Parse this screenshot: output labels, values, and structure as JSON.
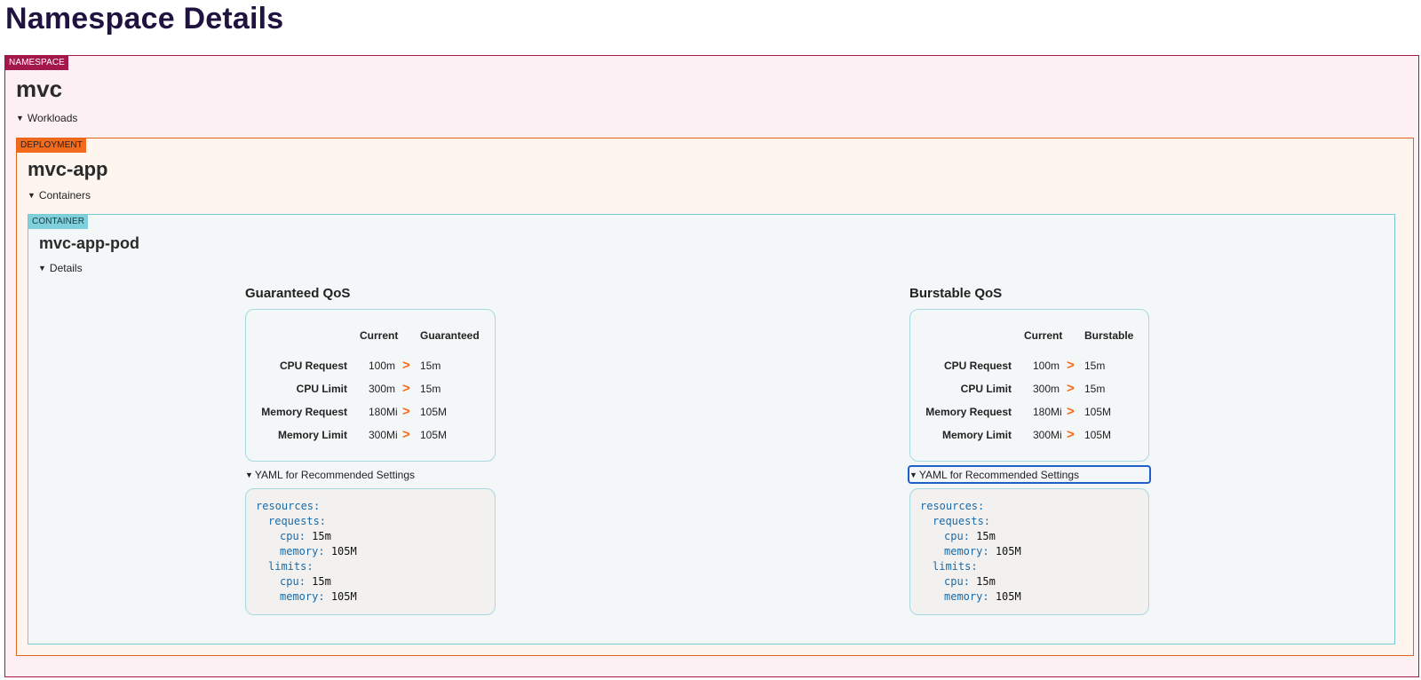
{
  "page": {
    "title": "Namespace Details"
  },
  "namespace": {
    "tag": "NAMESPACE",
    "name": "mvc",
    "section_label": "Workloads"
  },
  "deployment": {
    "tag": "DEPLOYMENT",
    "name": "mvc-app",
    "section_label": "Containers"
  },
  "container": {
    "tag": "CONTAINER",
    "name": "mvc-app-pod",
    "section_label": "Details"
  },
  "qos": [
    {
      "title": "Guaranteed QoS",
      "header_current": "Current",
      "header_recommended": "Guaranteed",
      "arrow": ">",
      "rows": [
        {
          "label": "CPU Request",
          "current": "100m",
          "recommended": "15m"
        },
        {
          "label": "CPU Limit",
          "current": "300m",
          "recommended": "15m"
        },
        {
          "label": "Memory Request",
          "current": "180Mi",
          "recommended": "105M"
        },
        {
          "label": "Memory Limit",
          "current": "300Mi",
          "recommended": "105M"
        }
      ],
      "yaml_summary": "YAML for Recommended Settings",
      "yaml": {
        "resources": "resources",
        "requests": "requests",
        "limits": "limits",
        "cpu_key": "cpu",
        "memory_key": "memory",
        "requests_cpu": "15m",
        "requests_memory": "105M",
        "limits_cpu": "15m",
        "limits_memory": "105M"
      }
    },
    {
      "title": "Burstable QoS",
      "header_current": "Current",
      "header_recommended": "Burstable",
      "arrow": ">",
      "rows": [
        {
          "label": "CPU Request",
          "current": "100m",
          "recommended": "15m"
        },
        {
          "label": "CPU Limit",
          "current": "300m",
          "recommended": "15m"
        },
        {
          "label": "Memory Request",
          "current": "180Mi",
          "recommended": "105M"
        },
        {
          "label": "Memory Limit",
          "current": "300Mi",
          "recommended": "105M"
        }
      ],
      "yaml_summary": "YAML for Recommended Settings",
      "yaml": {
        "resources": "resources",
        "requests": "requests",
        "limits": "limits",
        "cpu_key": "cpu",
        "memory_key": "memory",
        "requests_cpu": "15m",
        "requests_memory": "105M",
        "limits_cpu": "15m",
        "limits_memory": "105M"
      }
    }
  ],
  "icons": {
    "expanded": "triangle-down-icon",
    "arrow": "chevron-right-icon"
  },
  "colors": {
    "namespace": "#a4174a",
    "deployment": "#f26a1b",
    "container": "#7fd0da",
    "yaml_key": "#1a6aa6",
    "focus": "#1e5fc9"
  }
}
